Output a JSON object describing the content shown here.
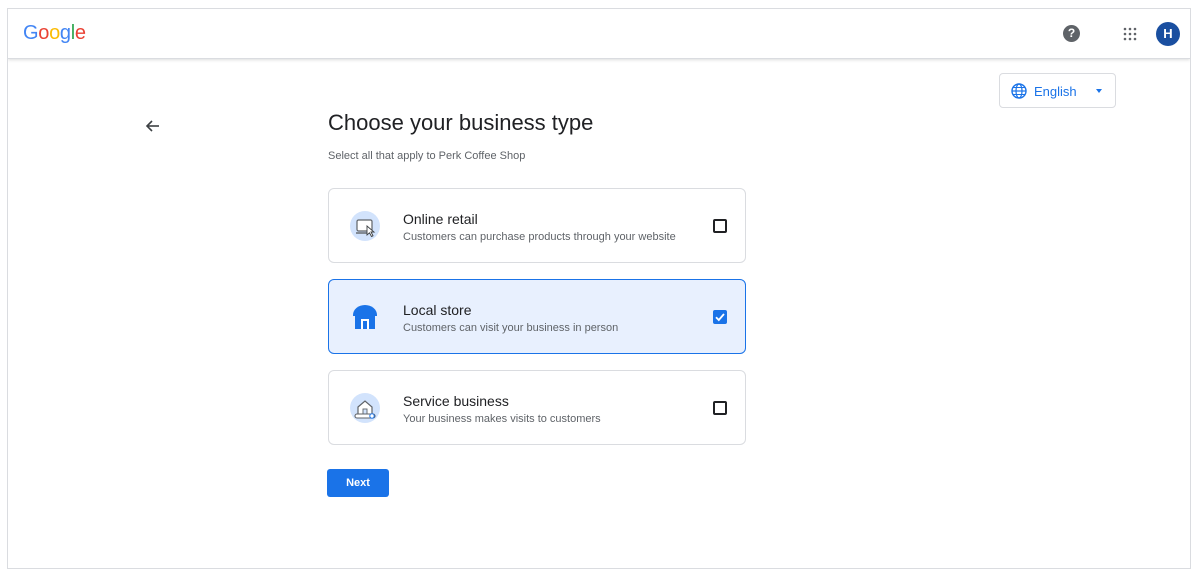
{
  "header": {
    "logo_letters": [
      {
        "char": "G",
        "color": "#4285f4"
      },
      {
        "char": "o",
        "color": "#ea4335"
      },
      {
        "char": "o",
        "color": "#fbbc05"
      },
      {
        "char": "g",
        "color": "#4285f4"
      },
      {
        "char": "l",
        "color": "#34a853"
      },
      {
        "char": "e",
        "color": "#ea4335"
      }
    ],
    "help_icon": "help-icon",
    "help_glyph": "?",
    "apps_icon": "apps-grid-icon",
    "avatar_initial": "H",
    "avatar_color": "#1a4fa0"
  },
  "language": {
    "label": "English",
    "icon": "globe-icon"
  },
  "main": {
    "title": "Choose your business type",
    "subtitle": "Select all that apply to Perk Coffee Shop",
    "options": [
      {
        "title": "Online retail",
        "description": "Customers can purchase products through your website",
        "icon": "online-retail-icon",
        "checked": false
      },
      {
        "title": "Local store",
        "description": "Customers can visit your business in person",
        "icon": "storefront-icon",
        "checked": true
      },
      {
        "title": "Service business",
        "description": "Your business makes visits to customers",
        "icon": "service-business-icon",
        "checked": false
      }
    ],
    "next_label": "Next"
  },
  "colors": {
    "accent": "#1a73e8",
    "selected_bg": "#e8f0fe",
    "border": "#dadce0"
  }
}
